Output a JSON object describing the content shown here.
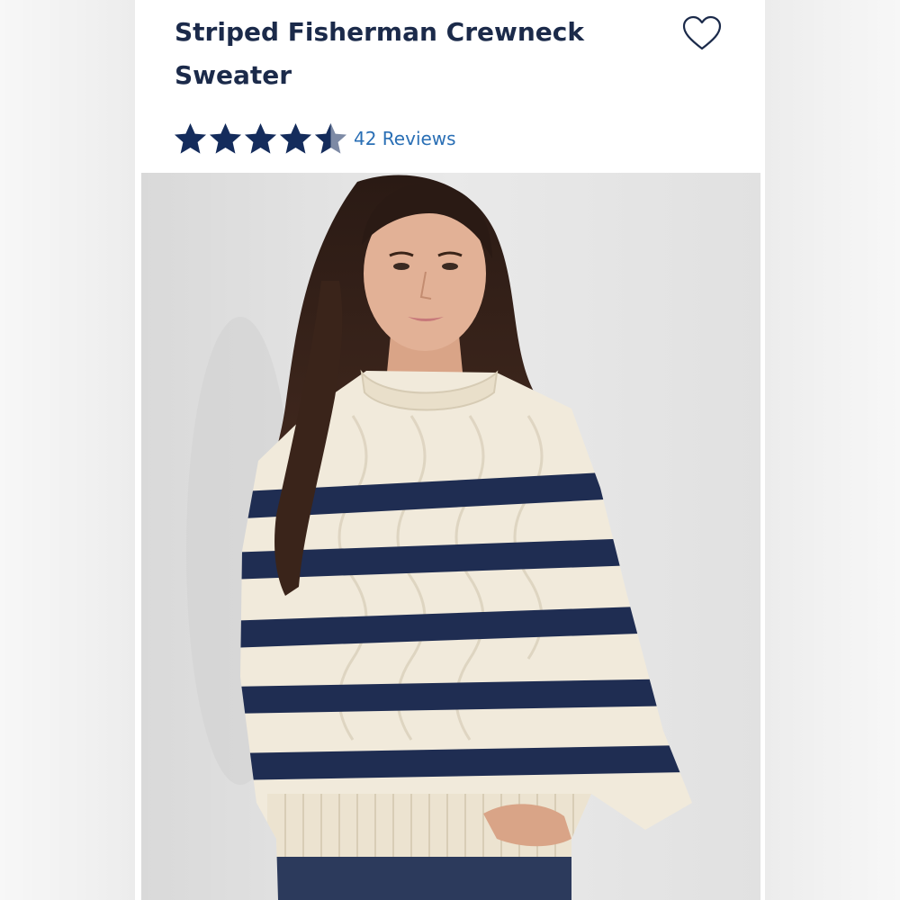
{
  "product": {
    "title": "Striped Fisherman Crewneck Sweater",
    "rating": 4.5,
    "rating_max": 5,
    "reviews_label": "42 Reviews",
    "wishlist_icon": "heart-outline-icon",
    "image_name": "model-wearing-striped-sweater"
  },
  "colors": {
    "title": "#1b2a4a",
    "star": "#142c5c",
    "link": "#2a6fb5",
    "sweater_cream": "#f1eadb",
    "stripe_navy": "#1f2d52"
  }
}
